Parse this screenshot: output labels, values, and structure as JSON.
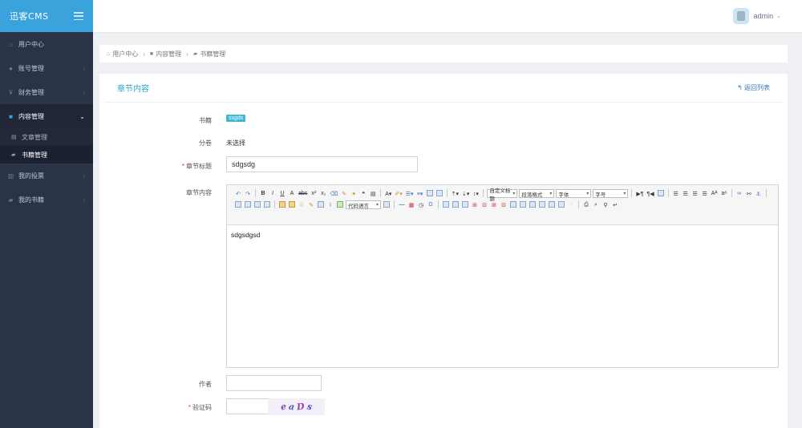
{
  "app": {
    "title": "迅客CMS"
  },
  "topbar": {
    "username": "admin"
  },
  "sidebar": {
    "items": [
      {
        "label": "用户中心",
        "icon": "home-icon"
      },
      {
        "label": "账号管理",
        "icon": "user-icon"
      },
      {
        "label": "财务管理",
        "icon": "yen-icon"
      },
      {
        "label": "内容管理",
        "icon": "grid-icon",
        "active": true
      },
      {
        "label": "我的投票",
        "icon": "bar-chart-icon"
      },
      {
        "label": "我的书籍",
        "icon": "book-icon"
      }
    ],
    "submenu": [
      {
        "label": "文章管理",
        "icon": "document-icon"
      },
      {
        "label": "书籍管理",
        "icon": "book-icon",
        "active": true
      }
    ]
  },
  "breadcrumb": [
    "用户中心",
    "内容管理",
    "书籍管理"
  ],
  "card": {
    "title": "章节内容",
    "back_label": "返回列表"
  },
  "form": {
    "book_label": "书籍",
    "book_value": "ssgds",
    "volume_label": "分卷",
    "volume_value": "未选择",
    "chapter_title_label": "章节标题",
    "chapter_title_value": "sdgsdg",
    "content_label": "章节内容",
    "content_value": "sdgsdgsd",
    "author_label": "作者",
    "author_value": "",
    "captcha_label": "验证码",
    "captcha_value": "",
    "captcha_text": "eaDs"
  },
  "editor": {
    "select_custom_title": "自定义标题",
    "select_paragraph": "段落格式",
    "select_font": "字体",
    "select_size": "字号",
    "select_code": "代码语言"
  },
  "colors": {
    "sidebar": "#2b3446",
    "logo": "#3aa3dc",
    "accent": "#2fa4c7",
    "tag": "#3fb7d0"
  }
}
